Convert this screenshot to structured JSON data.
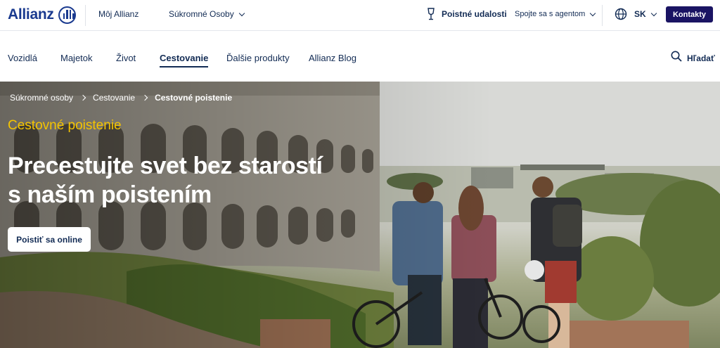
{
  "header": {
    "logo_text": "Allianz",
    "my_allianz": "Môj Allianz",
    "segment": "Súkromné Osoby",
    "claims": "Poistné udalosti",
    "agent": "Spojte sa s agentom",
    "language": "SK",
    "contacts_button": "Kontakty"
  },
  "nav": {
    "items": [
      "Vozidlá",
      "Majetok",
      "Život",
      "Cestovanie",
      "Ďalšie produkty",
      "Allianz Blog"
    ],
    "active": "Cestovanie",
    "search_label": "Hľadať"
  },
  "hero": {
    "breadcrumb": [
      "Súkromné osoby",
      "Cestovanie",
      "Cestovné poistenie"
    ],
    "eyebrow": "Cestovné poistenie",
    "headline_line1": "Precestujte svet bez starostí",
    "headline_line2": "s naším poistením",
    "cta_label": "Poistiť sa online"
  },
  "colors": {
    "brand_blue": "#1a3a8f",
    "text_navy": "#122b54",
    "contact_button_bg": "#1a1463",
    "eyebrow_yellow": "#f5c400"
  },
  "icons": [
    "allianz-logo-icon",
    "chevron-down-icon",
    "claims-glass-icon",
    "globe-icon",
    "search-icon",
    "chevron-right-icon"
  ]
}
